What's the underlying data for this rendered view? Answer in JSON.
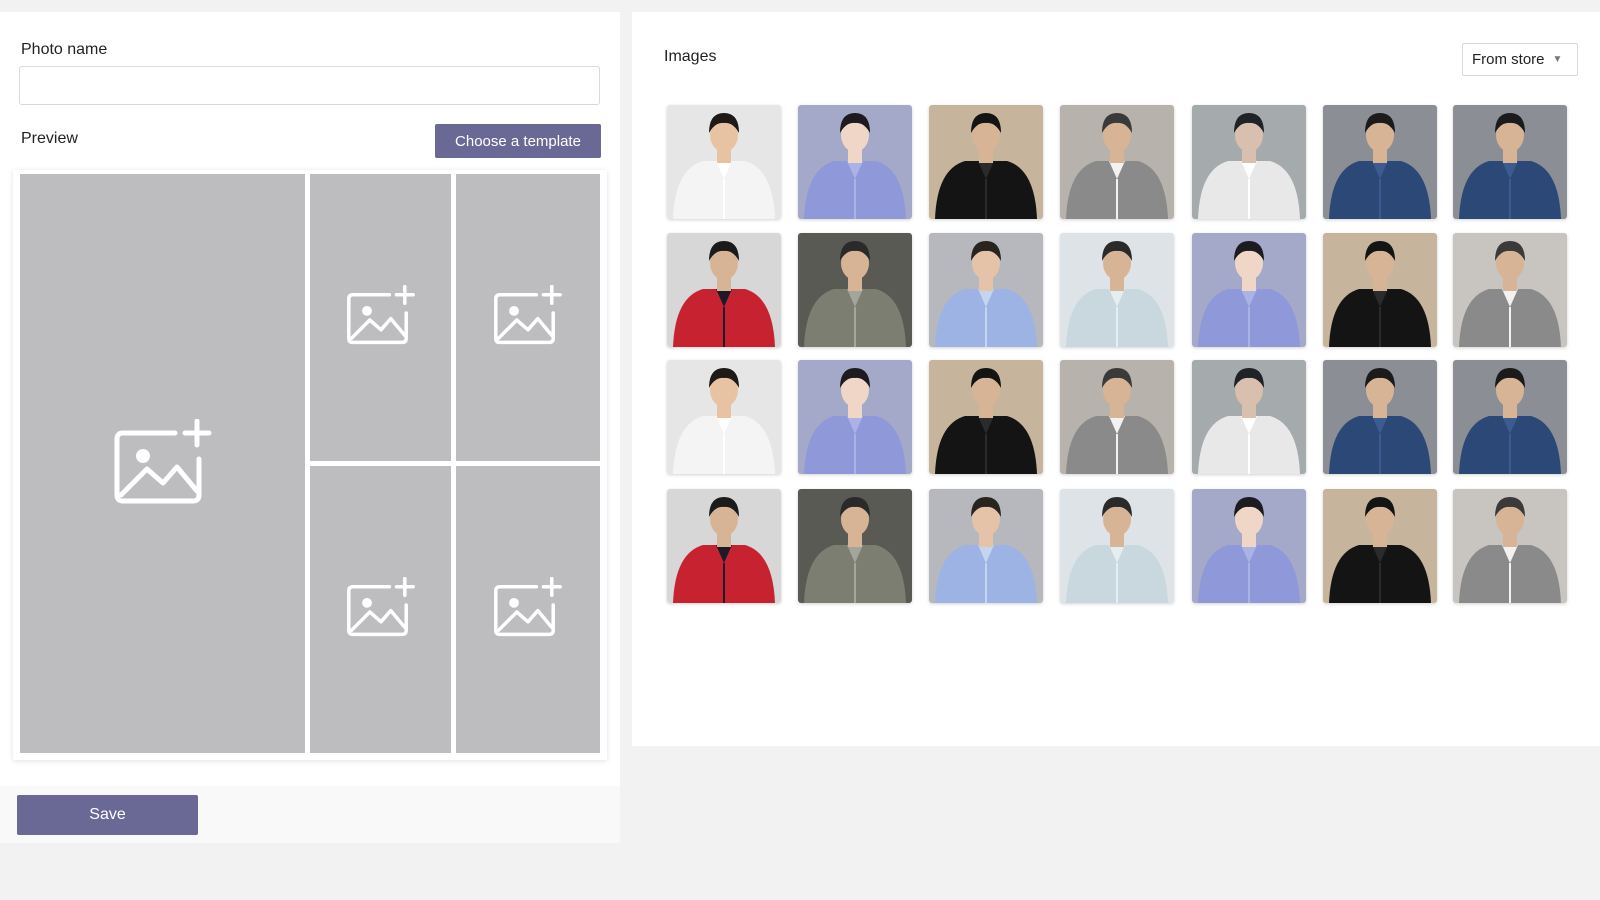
{
  "editor": {
    "name_label": "Photo name",
    "name_value": "",
    "name_placeholder": "",
    "preview_label": "Preview",
    "template_button": "Choose a template",
    "save_button": "Save",
    "slots": [
      "main",
      "top-middle",
      "top-right",
      "bottom-middle",
      "bottom-right"
    ],
    "slot_icon": "add-image-icon"
  },
  "images_panel": {
    "title": "Images",
    "source": "From store",
    "source_icon": "caret-down-icon"
  },
  "photos": [
    {
      "shirt": "#f4f4f4",
      "bg": "#e6e6e6",
      "skin": "#e7c3a4",
      "hair": "#1f1a18",
      "accent": "#ffffff"
    },
    {
      "shirt": "#8f99d9",
      "bg": "#a4a9c9",
      "skin": "#efd6c6",
      "hair": "#1d1b1f",
      "accent": "#aab2e6"
    },
    {
      "shirt": "#141414",
      "bg": "#c7b49c",
      "skin": "#d7b495",
      "hair": "#141414",
      "accent": "#2b2b2b"
    },
    {
      "shirt": "#8a8a8a",
      "bg": "#b7b2ac",
      "skin": "#d7b495",
      "hair": "#3a3a3a",
      "accent": "#f2f2f2"
    },
    {
      "shirt": "#e8e8e8",
      "bg": "#a5aaad",
      "skin": "#d8bfae",
      "hair": "#1f2226",
      "accent": "#ffffff"
    },
    {
      "shirt": "#2b4877",
      "bg": "#8b8e95",
      "skin": "#d7b495",
      "hair": "#1b1b1b",
      "accent": "#3b5b91"
    },
    {
      "shirt": "#2b4877",
      "bg": "#8b8e95",
      "skin": "#d7b495",
      "hair": "#1b1b1b",
      "accent": "#3b5b91"
    },
    {
      "shirt": "#c62230",
      "bg": "#d7d7d7",
      "skin": "#d7b495",
      "hair": "#1b1b1b",
      "accent": "#1b1b27"
    },
    {
      "shirt": "#7d7e72",
      "bg": "#5a5a55",
      "skin": "#d7b495",
      "hair": "#2a2a2a",
      "accent": "#a4a59c"
    },
    {
      "shirt": "#9cb3e3",
      "bg": "#b7b8bd",
      "skin": "#e4c3a9",
      "hair": "#2a2420",
      "accent": "#c5d4f1"
    },
    {
      "shirt": "#c9d7df",
      "bg": "#dde3e6",
      "skin": "#d7b495",
      "hair": "#2a2a2a",
      "accent": "#e4edf2"
    },
    {
      "shirt": "#8f99d9",
      "bg": "#a4a9c9",
      "skin": "#efd6c6",
      "hair": "#1d1b1f",
      "accent": "#aab2e6"
    },
    {
      "shirt": "#141414",
      "bg": "#c7b49c",
      "skin": "#d7b495",
      "hair": "#141414",
      "accent": "#2b2b2b"
    },
    {
      "shirt": "#8a8a8a",
      "bg": "#c8c4bf",
      "skin": "#d7b495",
      "hair": "#3a3a3a",
      "accent": "#f2f2f2"
    },
    {
      "shirt": "#f4f4f4",
      "bg": "#e6e6e6",
      "skin": "#e7c3a4",
      "hair": "#1f1a18",
      "accent": "#ffffff"
    },
    {
      "shirt": "#8f99d9",
      "bg": "#a4a9c9",
      "skin": "#efd6c6",
      "hair": "#1d1b1f",
      "accent": "#aab2e6"
    },
    {
      "shirt": "#141414",
      "bg": "#c7b49c",
      "skin": "#d7b495",
      "hair": "#141414",
      "accent": "#2b2b2b"
    },
    {
      "shirt": "#8a8a8a",
      "bg": "#b7b2ac",
      "skin": "#d7b495",
      "hair": "#3a3a3a",
      "accent": "#f2f2f2"
    },
    {
      "shirt": "#e8e8e8",
      "bg": "#a5aaad",
      "skin": "#d8bfae",
      "hair": "#1f2226",
      "accent": "#ffffff"
    },
    {
      "shirt": "#2b4877",
      "bg": "#8b8e95",
      "skin": "#d7b495",
      "hair": "#1b1b1b",
      "accent": "#3b5b91"
    },
    {
      "shirt": "#2b4877",
      "bg": "#8b8e95",
      "skin": "#d7b495",
      "hair": "#1b1b1b",
      "accent": "#3b5b91"
    },
    {
      "shirt": "#c62230",
      "bg": "#d7d7d7",
      "skin": "#d7b495",
      "hair": "#1b1b1b",
      "accent": "#1b1b27"
    },
    {
      "shirt": "#7d7e72",
      "bg": "#5a5a55",
      "skin": "#d7b495",
      "hair": "#2a2a2a",
      "accent": "#a4a59c"
    },
    {
      "shirt": "#9cb3e3",
      "bg": "#b7b8bd",
      "skin": "#e4c3a9",
      "hair": "#2a2420",
      "accent": "#c5d4f1"
    },
    {
      "shirt": "#c9d7df",
      "bg": "#dde3e6",
      "skin": "#d7b495",
      "hair": "#2a2a2a",
      "accent": "#e4edf2"
    },
    {
      "shirt": "#8f99d9",
      "bg": "#a4a9c9",
      "skin": "#efd6c6",
      "hair": "#1d1b1f",
      "accent": "#aab2e6"
    },
    {
      "shirt": "#141414",
      "bg": "#c7b49c",
      "skin": "#d7b495",
      "hair": "#141414",
      "accent": "#2b2b2b"
    },
    {
      "shirt": "#8a8a8a",
      "bg": "#c8c4bf",
      "skin": "#d7b495",
      "hair": "#3a3a3a",
      "accent": "#f2f2f2"
    }
  ],
  "colors": {
    "primary": "#6a6895",
    "slot": "#bdbdc0",
    "page_bg": "#f2f2f2",
    "panel_bg": "#ffffff"
  }
}
